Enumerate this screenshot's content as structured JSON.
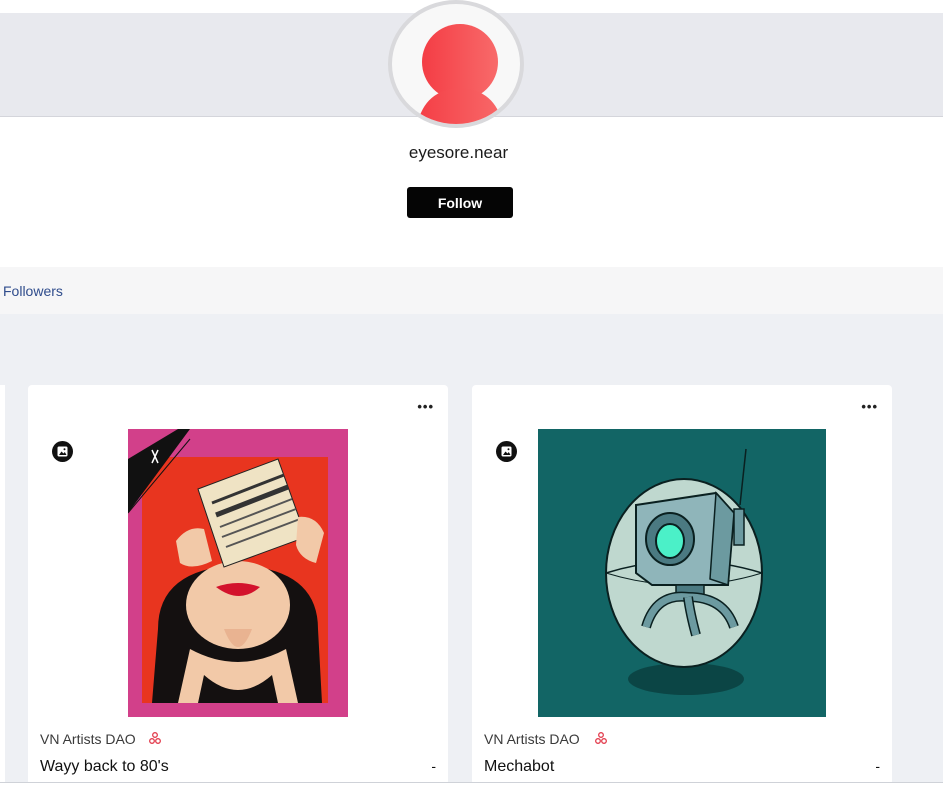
{
  "profile": {
    "username": "eyesore.near",
    "follow_label": "Follow",
    "avatar_icon": "user-avatar-icon",
    "avatar_color": "#f34b4f"
  },
  "tabs": {
    "followers_label": "Followers"
  },
  "cards": [
    {
      "collection": "VN Artists DAO",
      "title": "Wayy back to 80's",
      "price": "-",
      "menu_label": "•••",
      "type_icon": "image-icon"
    },
    {
      "collection": "VN Artists DAO",
      "title": "Mechabot",
      "price": "-",
      "menu_label": "•••",
      "type_icon": "image-icon"
    }
  ],
  "colors": {
    "accent_link": "#2f4c8c",
    "button_bg": "#050505",
    "card1_frame": "#d2408a",
    "card2_bg": "#126565"
  }
}
